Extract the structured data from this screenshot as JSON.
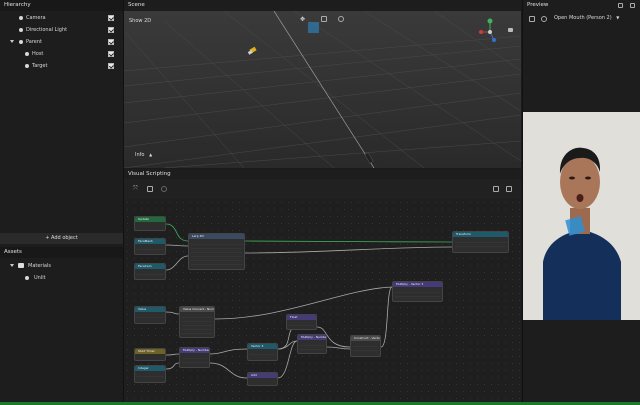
{
  "hierarchy": {
    "title": "Hierarchy",
    "items": [
      {
        "label": "Camera"
      },
      {
        "label": "Directional Light"
      },
      {
        "label": "Parent"
      },
      {
        "label": "Host"
      },
      {
        "label": "Target"
      }
    ],
    "add_object": "+ Add object"
  },
  "assets": {
    "title": "Assets",
    "items": [
      {
        "label": "Materials"
      },
      {
        "label": "Unlit"
      }
    ]
  },
  "scene": {
    "title": "Scene",
    "show2d": "Show 2D",
    "info": "Info"
  },
  "visual_scripting": {
    "title": "Visual Scripting",
    "nodes": [
      {
        "label": "Update"
      },
      {
        "label": "FaceMesh"
      },
      {
        "label": "FaceCam"
      },
      {
        "label": "Lerp 3D"
      },
      {
        "label": "Transform"
      },
      {
        "label": "Value"
      },
      {
        "label": "Value Convert - Number"
      },
      {
        "label": "Multiply - Vector 3"
      },
      {
        "label": "Start Timer"
      },
      {
        "label": "Multiply - Number"
      },
      {
        "label": "Integer"
      },
      {
        "label": "Float"
      },
      {
        "label": "Multiply - Number"
      },
      {
        "label": "Vector 3"
      },
      {
        "label": "Construct - Vector 3"
      },
      {
        "label": "Add"
      }
    ]
  },
  "preview": {
    "title": "Preview",
    "dropdown": "Open Mouth (Person 2)"
  },
  "colors": {
    "accent_green": "#3fb25f",
    "cube_blue": "#2c8fd6"
  }
}
